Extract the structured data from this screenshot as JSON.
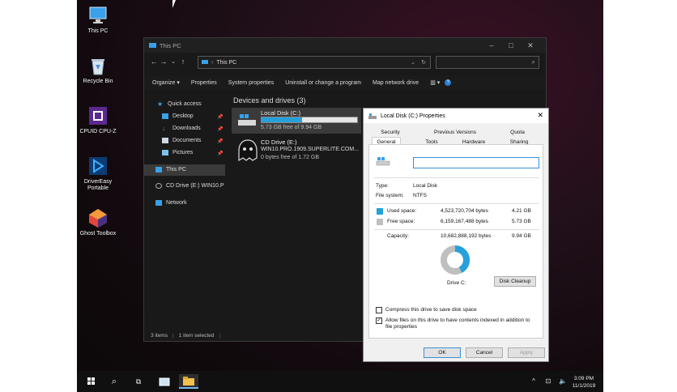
{
  "desktop": {
    "icons": [
      {
        "label": "This PC",
        "icon": "this-pc-icon"
      },
      {
        "label": "Recycle Bin",
        "icon": "recycle-bin-icon"
      },
      {
        "label": "CPUID CPU-Z",
        "icon": "cpuz-icon"
      },
      {
        "label": "DriverEasy Portable",
        "icon": "drivereasy-icon"
      },
      {
        "label": "Ghost Toolbox",
        "icon": "ghost-toolbox-icon"
      }
    ]
  },
  "explorer": {
    "title": "This PC",
    "address": "This PC",
    "commands": [
      "Organize ▾",
      "Properties",
      "System properties",
      "Uninstall or change a program",
      "Map network drive"
    ],
    "quick_access": "Quick access",
    "nav_items": [
      "Desktop",
      "Downloads",
      "Documents",
      "Pictures"
    ],
    "this_pc": "This PC",
    "cd_drive_nav": "CD Drive (E:) WIN10.P",
    "network": "Network",
    "section_header": "Devices and drives (3)",
    "drives": [
      {
        "name": "Local Disk (C:)",
        "detail": "5.73 GB free of 9.94 GB",
        "used_fraction": 0.42
      },
      {
        "name": "CD Drive (E:)",
        "detail_line1": "WIN10.PRO.1909.SUPERLITE.COM...",
        "detail": "0 bytes free of 1.72 GB"
      }
    ],
    "status_items": "3 items",
    "status_selected": "1 item selected"
  },
  "properties": {
    "title": "Local Disk (C:) Properties",
    "tabs_top": [
      "Security",
      "Previous Versions",
      "Quota"
    ],
    "tabs_bottom": [
      "General",
      "Tools",
      "Hardware",
      "Sharing"
    ],
    "name_value": "",
    "type_label": "Type:",
    "type_value": "Local Disk",
    "fs_label": "File system:",
    "fs_value": "NTFS",
    "used_label": "Used space:",
    "used_bytes": "4,523,720,704 bytes",
    "used_gb": "4.21 GB",
    "free_label": "Free space:",
    "free_bytes": "6,159,167,488 bytes",
    "free_gb": "5.73 GB",
    "capacity_label": "Capacity:",
    "capacity_bytes": "10,682,888,192 bytes",
    "capacity_gb": "9.94 GB",
    "drive_label": "Drive C:",
    "disk_cleanup": "Disk Cleanup",
    "compress_label": "Compress this drive to save disk space",
    "index_label_1": "Allow files on this drive to have contents indexed in addition to",
    "index_label_2": "file properties",
    "ok": "OK",
    "cancel": "Cancel",
    "apply": "Apply",
    "used_fraction": 0.42,
    "colors": {
      "used": "#26a0da",
      "free": "#bfbfbf"
    }
  },
  "taskbar": {
    "time": "3:09 PM",
    "date": "11/1/2019"
  }
}
